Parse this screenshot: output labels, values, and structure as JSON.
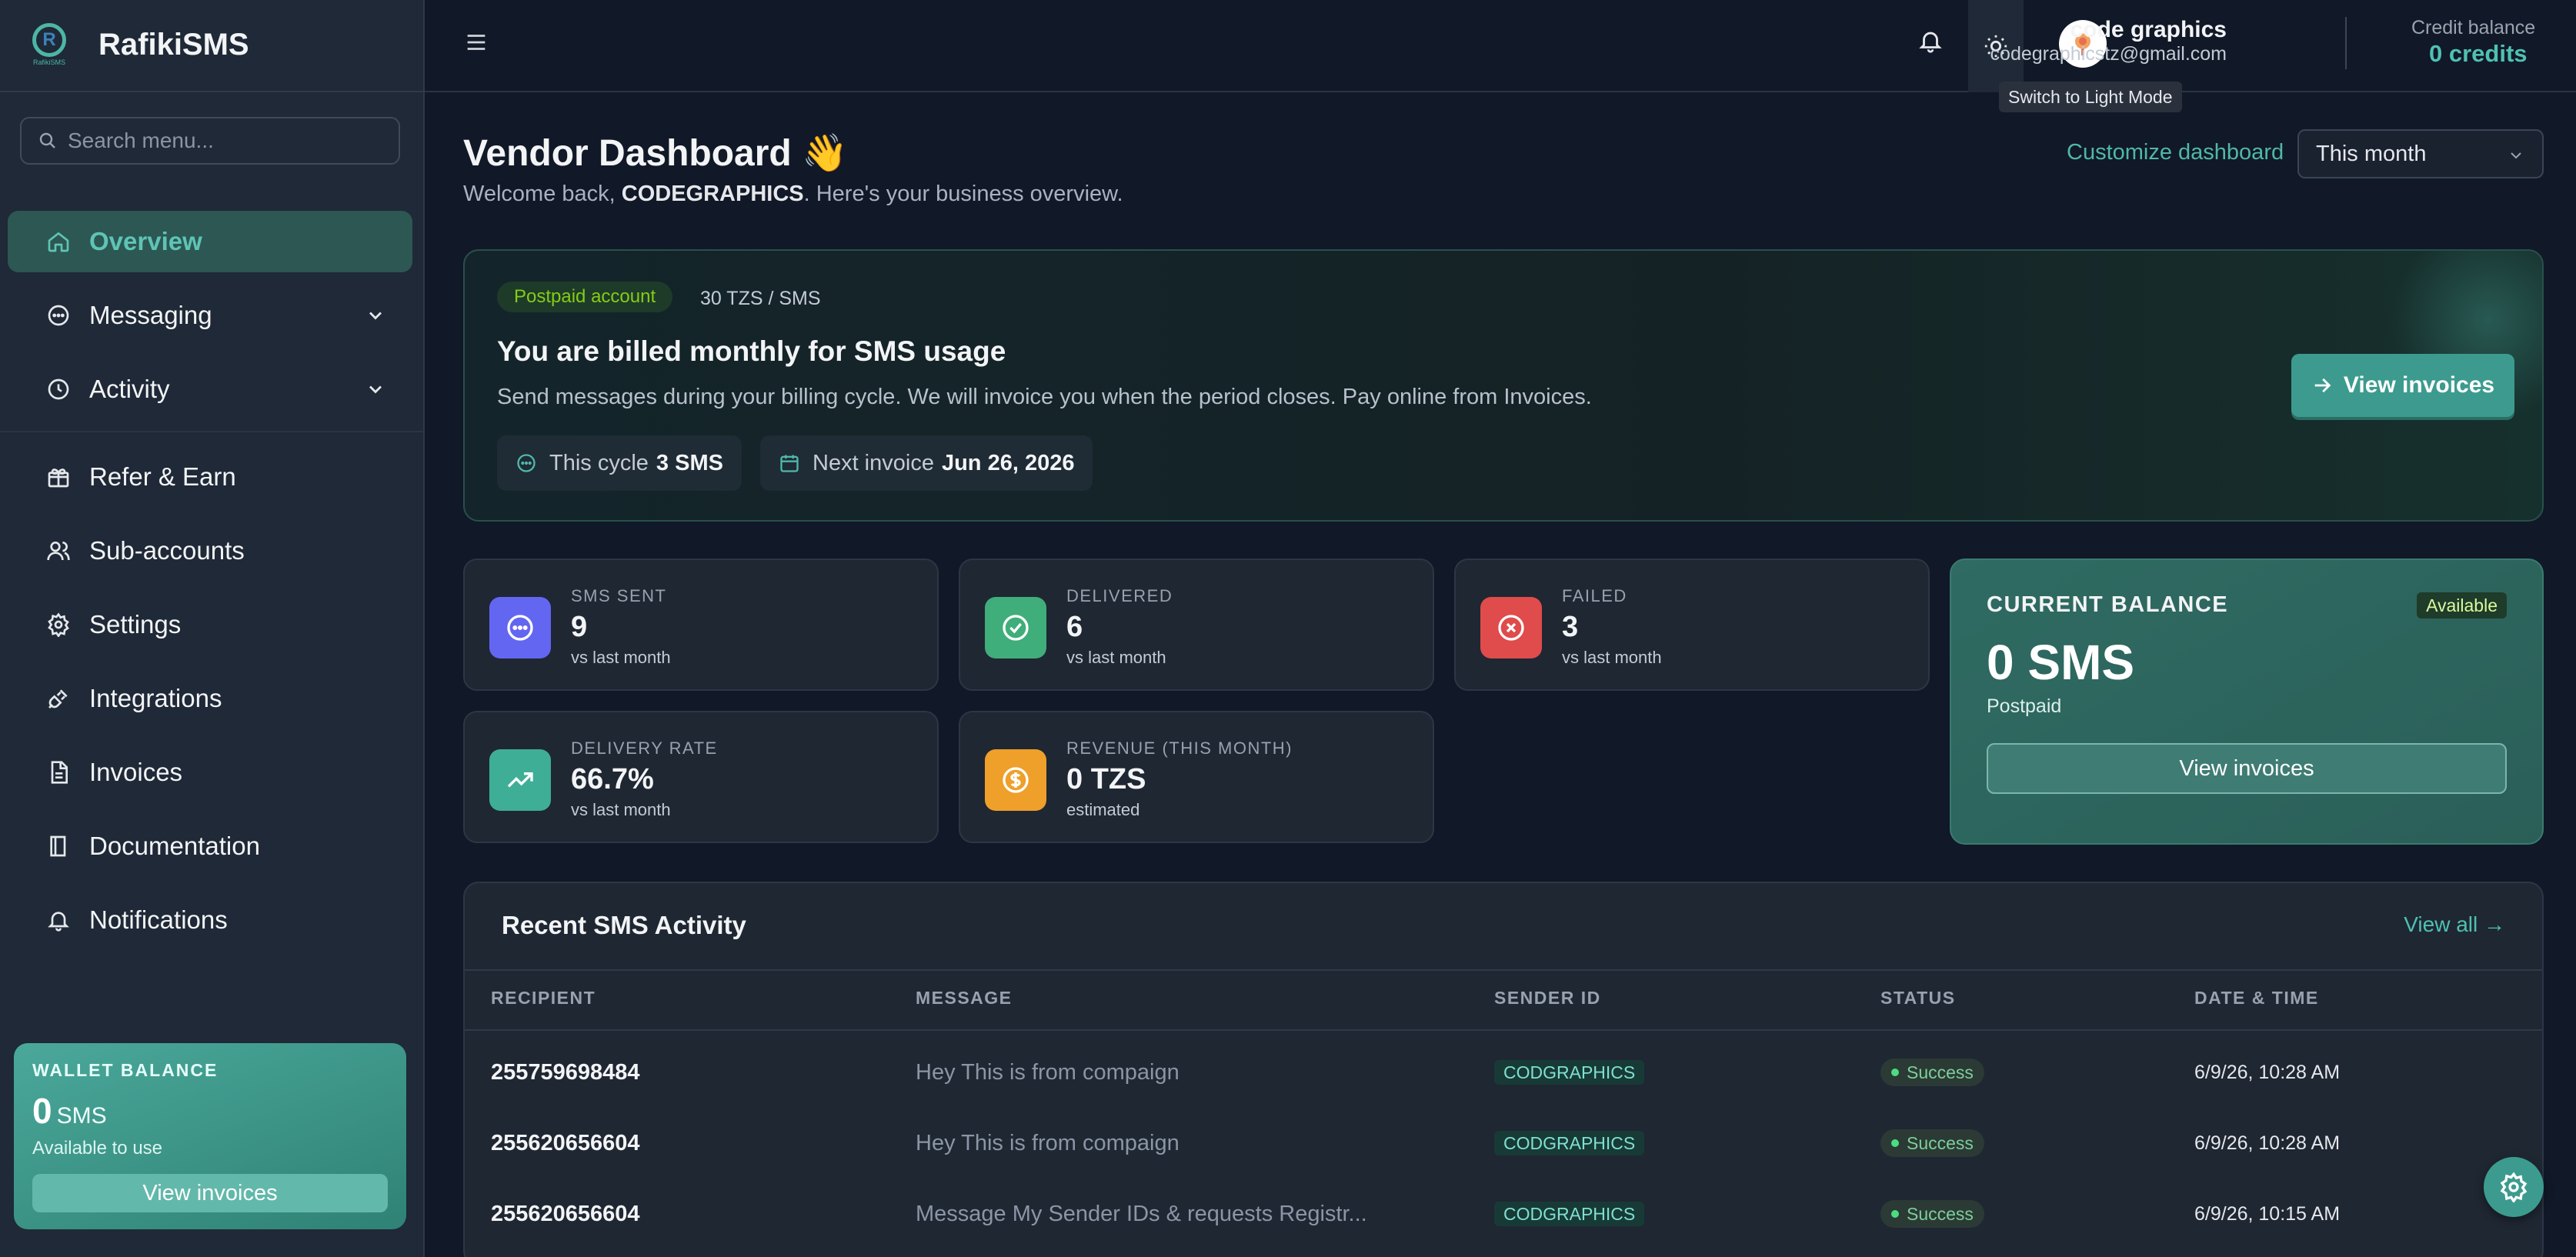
{
  "app": {
    "name": "RafikiSMS",
    "logo_text": "RafikiSMS"
  },
  "sidebar": {
    "search_placeholder": "Search menu...",
    "items": [
      {
        "label": "Overview",
        "icon": "home-icon",
        "active": true
      },
      {
        "label": "Messaging",
        "icon": "chat-icon",
        "expandable": true
      },
      {
        "label": "Activity",
        "icon": "history-icon",
        "expandable": true
      },
      {
        "label": "Refer & Earn",
        "icon": "gift-icon"
      },
      {
        "label": "Sub-accounts",
        "icon": "users-icon"
      },
      {
        "label": "Settings",
        "icon": "gear-icon"
      },
      {
        "label": "Integrations",
        "icon": "plug-icon"
      },
      {
        "label": "Invoices",
        "icon": "invoice-icon"
      },
      {
        "label": "Documentation",
        "icon": "book-icon"
      },
      {
        "label": "Notifications",
        "icon": "bell-icon"
      }
    ],
    "wallet": {
      "label": "WALLET BALANCE",
      "amount": "0",
      "unit": "SMS",
      "sub": "Available to use",
      "button": "View invoices"
    }
  },
  "topbar": {
    "user_name": "code graphics",
    "user_email": "codegraphicstz@gmail.com",
    "credit_label": "Credit balance",
    "credit_value": "0 credits",
    "theme_tooltip": "Switch to Light Mode"
  },
  "header": {
    "title": "Vendor Dashboard",
    "title_emoji": "👋",
    "welcome_prefix": "Welcome back, ",
    "welcome_name": "CODEGRAPHICS",
    "welcome_suffix": ". Here's your business overview.",
    "customize": "Customize dashboard",
    "period": "This month"
  },
  "billing": {
    "badge": "Postpaid account",
    "rate": "30 TZS / SMS",
    "title": "You are billed monthly for SMS usage",
    "description": "Send messages during your billing cycle. We will invoice you when the period closes. Pay online from Invoices.",
    "cycle_label": "This cycle",
    "cycle_value": "3 SMS",
    "next_label": "Next invoice",
    "next_value": "Jun 26, 2026",
    "button": "View invoices"
  },
  "stats": [
    {
      "label": "SMS SENT",
      "value": "9",
      "sub": "vs last month",
      "color": "#6366f1",
      "icon": "message-dots-icon"
    },
    {
      "label": "DELIVERED",
      "value": "6",
      "sub": "vs last month",
      "color": "#3fae7a",
      "icon": "check-circle-icon"
    },
    {
      "label": "FAILED",
      "value": "3",
      "sub": "vs last month",
      "color": "#e04b4b",
      "icon": "x-circle-icon"
    },
    {
      "label": "DELIVERY RATE",
      "value": "66.7%",
      "sub": "vs last month",
      "color": "#3fae96",
      "icon": "trend-up-icon"
    },
    {
      "label": "REVENUE (THIS MONTH)",
      "value": "0 TZS",
      "sub": "estimated",
      "color": "#eea02a",
      "icon": "dollar-circle-icon"
    }
  ],
  "balance": {
    "label": "CURRENT BALANCE",
    "badge": "Available",
    "amount": "0 SMS",
    "sub": "Postpaid",
    "button": "View invoices"
  },
  "activity": {
    "title": "Recent SMS Activity",
    "view_all": "View all →",
    "columns": [
      "RECIPIENT",
      "MESSAGE",
      "SENDER ID",
      "STATUS",
      "DATE & TIME"
    ],
    "rows": [
      {
        "recipient": "255759698484",
        "message": "Hey This is from compaign",
        "sender": "CODGRAPHICS",
        "status": "Success",
        "date": "6/9/26, 10:28 AM"
      },
      {
        "recipient": "255620656604",
        "message": "Hey This is from compaign",
        "sender": "CODGRAPHICS",
        "status": "Success",
        "date": "6/9/26, 10:28 AM"
      },
      {
        "recipient": "255620656604",
        "message": "Message My Sender IDs & requests Registr...",
        "sender": "CODGRAPHICS",
        "status": "Success",
        "date": "6/9/26, 10:15 AM"
      }
    ]
  },
  "colors": {
    "accent": "#4fc1b2",
    "background": "#111827",
    "sidebar": "#1f2937"
  }
}
